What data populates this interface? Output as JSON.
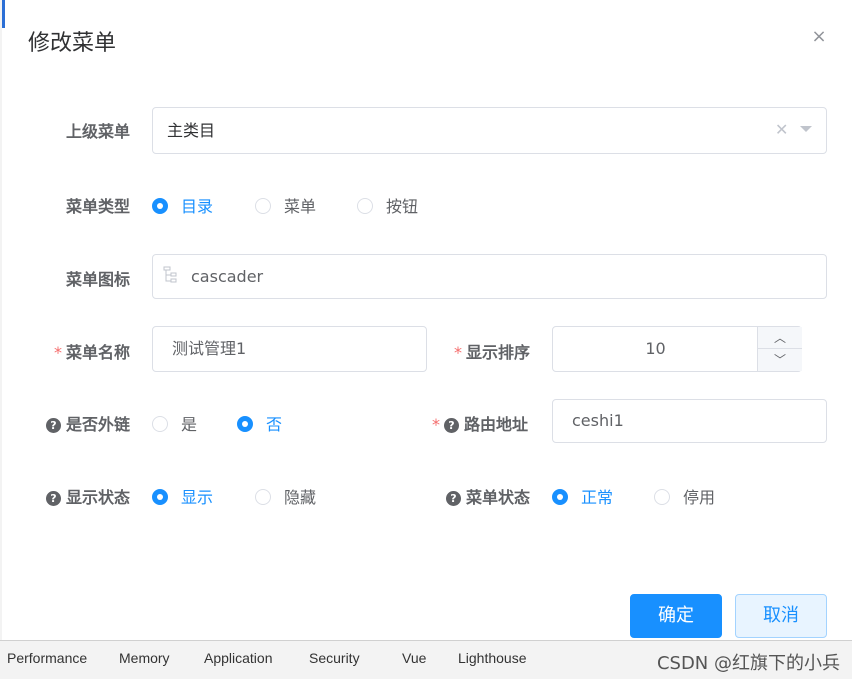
{
  "dialog": {
    "title": "修改菜单",
    "close_symbol": "×"
  },
  "form": {
    "parent_menu": {
      "label": "上级菜单",
      "value": "主类目"
    },
    "menu_type": {
      "label": "菜单类型",
      "options": [
        "目录",
        "菜单",
        "按钮"
      ],
      "selected": "目录"
    },
    "menu_icon": {
      "label": "菜单图标",
      "value": "cascader"
    },
    "menu_name": {
      "label": "菜单名称",
      "value": "测试管理1",
      "required": "*"
    },
    "sort_order": {
      "label": "显示排序",
      "value": "10",
      "required": "*"
    },
    "external_link": {
      "label": "是否外链",
      "options": [
        "是",
        "否"
      ],
      "selected": "否"
    },
    "route_path": {
      "label": "路由地址",
      "value": "ceshi1",
      "required": "*"
    },
    "visible": {
      "label": "显示状态",
      "options": [
        "显示",
        "隐藏"
      ],
      "selected": "显示"
    },
    "status": {
      "label": "菜单状态",
      "options": [
        "正常",
        "停用"
      ],
      "selected": "正常"
    }
  },
  "buttons": {
    "confirm": "确定",
    "cancel": "取消"
  },
  "devtools": {
    "tabs": [
      "Performance",
      "Memory",
      "Application",
      "Security",
      "Vue",
      "Lighthouse"
    ]
  },
  "watermark": "CSDN @红旗下的小兵",
  "colors": {
    "primary": "#1890ff",
    "required": "#f56c6c",
    "label": "#606266"
  }
}
